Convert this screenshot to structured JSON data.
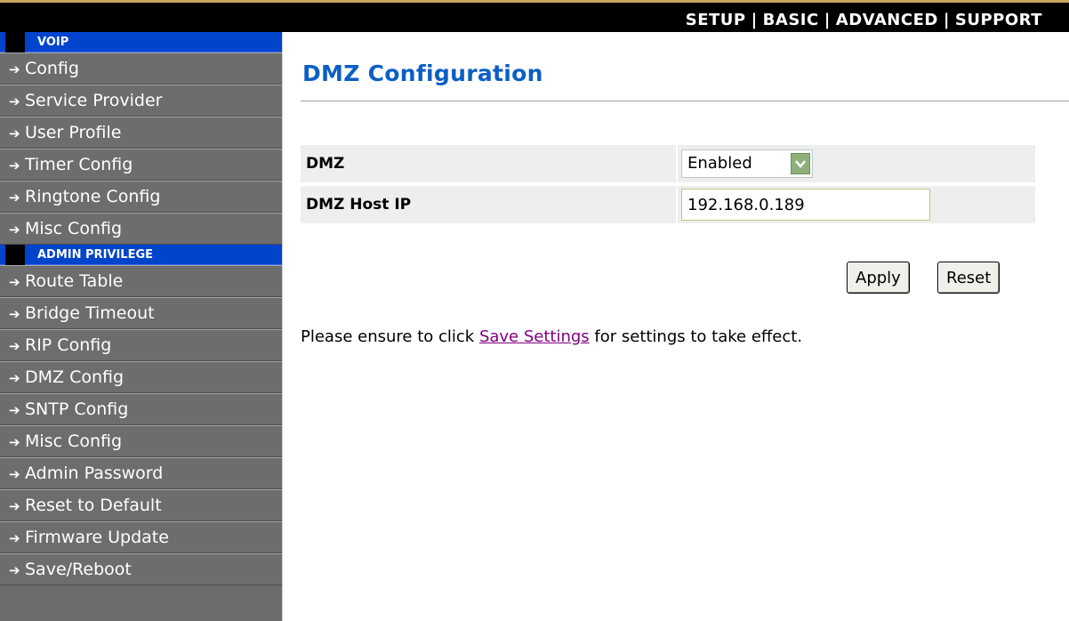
{
  "top_nav": {
    "items": [
      "SETUP",
      "BASIC",
      "ADVANCED",
      "SUPPORT"
    ],
    "separator": "|"
  },
  "sidebar": {
    "sections": [
      {
        "header": "VOIP",
        "items": [
          "Config",
          "Service Provider",
          "User Profile",
          "Timer Config",
          "Ringtone Config",
          "Misc Config"
        ]
      },
      {
        "header": "ADMIN PRIVILEGE",
        "items": [
          "Route Table",
          "Bridge Timeout",
          "RIP Config",
          "DMZ Config",
          "SNTP Config",
          "Misc Config",
          "Admin Password",
          "Reset to Default",
          "Firmware Update",
          "Save/Reboot"
        ]
      }
    ],
    "arrow_glyph": "➔"
  },
  "main": {
    "title": "DMZ Configuration",
    "dmz": {
      "label": "DMZ",
      "value": "Enabled"
    },
    "host_ip": {
      "label": "DMZ Host IP",
      "value": "192.168.0.189"
    },
    "apply_label": "Apply",
    "reset_label": "Reset",
    "note": {
      "before": "Please ensure to click ",
      "link": "Save Settings",
      "after": " for settings to take effect."
    }
  },
  "colors": {
    "title": "#0b5fc4",
    "section_header": "#0044cc",
    "sidebar_bg": "#6d6d6d",
    "link_visited": "#800080"
  }
}
